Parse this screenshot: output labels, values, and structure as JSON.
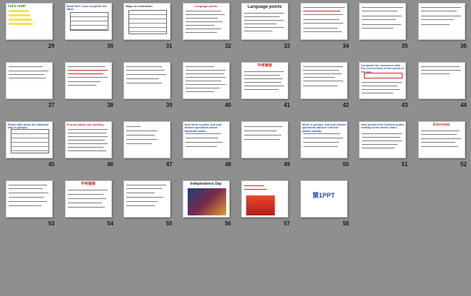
{
  "colors": {
    "background": "#8f8f8f",
    "title_red": "#cc2222",
    "title_blue": "#2a4fa8",
    "highlight": "#f6e24b"
  },
  "slides": [
    {
      "n": "29",
      "title": "Let's read!"
    },
    {
      "n": "30",
      "title": "Read Part 1 and complete the table."
    },
    {
      "n": "31",
      "title": "Ways of celebration"
    },
    {
      "n": "32",
      "title": "Language points"
    },
    {
      "n": "33",
      "title": "Language points"
    },
    {
      "n": "34",
      "title": ""
    },
    {
      "n": "35",
      "title": ""
    },
    {
      "n": "36",
      "title": ""
    },
    {
      "n": "37",
      "title": ""
    },
    {
      "n": "38",
      "title": ""
    },
    {
      "n": "39",
      "title": ""
    },
    {
      "n": "40",
      "title": ""
    },
    {
      "n": "41",
      "title": "中考链接"
    },
    {
      "n": "42",
      "title": ""
    },
    {
      "n": "43",
      "title": "Complete the sentences with the correct form of the words in the box."
    },
    {
      "n": "44",
      "title": ""
    },
    {
      "n": "45",
      "title": "Please talk about the National Day in groups."
    },
    {
      "n": "46",
      "title": "Pronunciation and spelling"
    },
    {
      "n": "47",
      "title": ""
    },
    {
      "n": "48",
      "title": "Now work in pairs. Ask and answer questions about important dates."
    },
    {
      "n": "49",
      "title": ""
    },
    {
      "n": "50",
      "title": "Work in groups. Ask and answer questions about a Chinese public holiday."
    },
    {
      "n": "51",
      "title": "Now present the Chinese public holiday to the whole class."
    },
    {
      "n": "52",
      "title": "Exercises"
    },
    {
      "n": "53",
      "title": ""
    },
    {
      "n": "54",
      "title": "中考链接"
    },
    {
      "n": "55",
      "title": ""
    },
    {
      "n": "56",
      "title": "Independence Day"
    },
    {
      "n": "57",
      "title": ""
    },
    {
      "n": "58",
      "title": "第1PPT"
    }
  ]
}
